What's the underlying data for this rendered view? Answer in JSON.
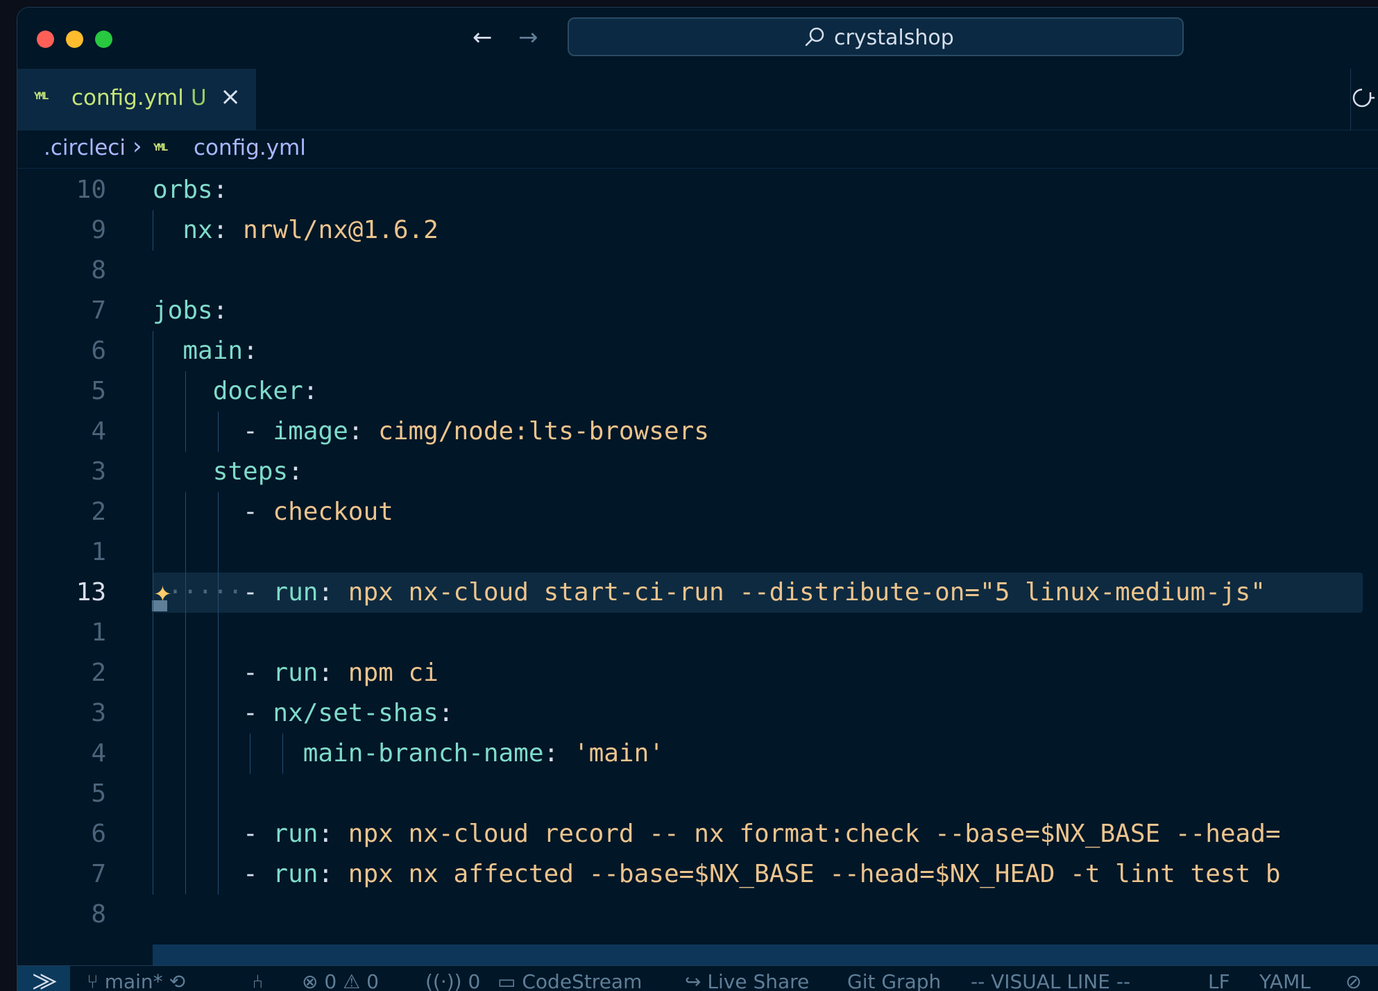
{
  "window": {
    "search_text": "crystalshop"
  },
  "tab": {
    "icon": "yml-icon",
    "icon_text": "YML",
    "name": "config.yml",
    "status": "U"
  },
  "breadcrumb": {
    "folder": ".circleci",
    "file": "config.yml"
  },
  "editor": {
    "lines": [
      {
        "num": "10",
        "indent": 0,
        "key": "orbs",
        "value": ""
      },
      {
        "num": "9",
        "indent": 1,
        "key": "nx",
        "value": "nrwl/nx@1.6.2"
      },
      {
        "num": "8",
        "indent": 0,
        "key": "",
        "value": ""
      },
      {
        "num": "7",
        "indent": 0,
        "key": "jobs",
        "value": ""
      },
      {
        "num": "6",
        "indent": 1,
        "key": "main",
        "value": ""
      },
      {
        "num": "5",
        "indent": 2,
        "key": "docker",
        "value": ""
      },
      {
        "num": "4",
        "indent": 3,
        "dash": true,
        "key": "image",
        "value": "cimg/node:lts-browsers"
      },
      {
        "num": "3",
        "indent": 2,
        "key": "steps",
        "value": ""
      },
      {
        "num": "2",
        "indent": 3,
        "dash": true,
        "key": "",
        "value": "checkout"
      },
      {
        "num": "1",
        "indent": 0,
        "key": "",
        "value": ""
      },
      {
        "num": "13",
        "current": true,
        "indent": 3,
        "dash": true,
        "key": "run",
        "value": "npx nx-cloud start-ci-run --distribute-on=\"5 linux-medium-js\""
      },
      {
        "num": "1",
        "indent": 0,
        "key": "",
        "value": ""
      },
      {
        "num": "2",
        "indent": 3,
        "dash": true,
        "key": "run",
        "value": "npm ci"
      },
      {
        "num": "3",
        "indent": 3,
        "dash": true,
        "key": "nx/set-shas",
        "value": ""
      },
      {
        "num": "4",
        "indent": 5,
        "key": "main-branch-name",
        "value": "'main'"
      },
      {
        "num": "5",
        "indent": 0,
        "key": "",
        "value": ""
      },
      {
        "num": "6",
        "indent": 3,
        "dash": true,
        "key": "run",
        "value": "npx nx-cloud record -- nx format:check --base=$NX_BASE --head="
      },
      {
        "num": "7",
        "indent": 3,
        "dash": true,
        "key": "run",
        "value": "npx nx affected --base=$NX_BASE --head=$NX_HEAD -t lint test b"
      },
      {
        "num": "8",
        "indent": 0,
        "key": "",
        "value": ""
      }
    ]
  },
  "statusbar": {
    "branch": "main*",
    "errors": "0",
    "warnings": "0",
    "ports": "0",
    "codestream": "CodeStream",
    "live_share": "Live Share",
    "git_graph": "Git Graph",
    "mode": "-- VISUAL LINE --",
    "eol": "LF",
    "language": "YAML"
  },
  "colors": {
    "background": "#011627",
    "key": "#7fdbca",
    "value": "#ecc48d",
    "tab_accent": "#c5e478",
    "breadcrumb": "#a9b7ff"
  }
}
